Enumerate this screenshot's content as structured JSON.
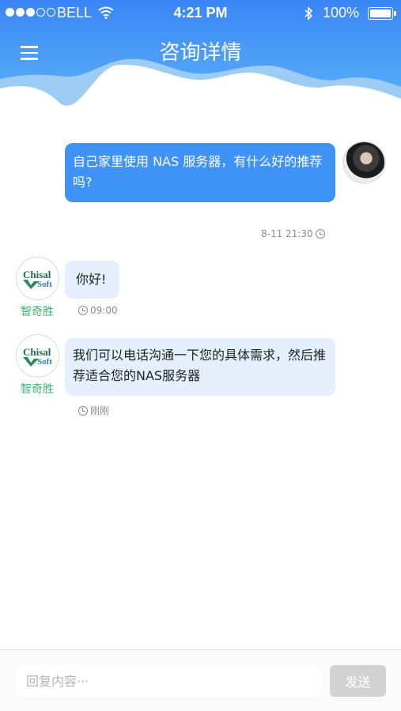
{
  "status_bar": {
    "carrier": "BELL",
    "time": "4:21 PM",
    "battery": "100%"
  },
  "header": {
    "title": "咨询详情"
  },
  "messages": {
    "outgoing": {
      "text": "自己家里使用 NAS 服务器，有什么好的推荐吗?",
      "timestamp": "8-11 21:30"
    },
    "incoming": [
      {
        "sender": "智奇胜",
        "text": "你好!",
        "timestamp": "09:00"
      },
      {
        "sender": "智奇胜",
        "text": "我们可以电话沟通一下您的具体需求，然后推荐适合您的NAS服务器",
        "timestamp": "刚刚"
      }
    ]
  },
  "agent_logo": {
    "line1": "Chisal",
    "line2": "Soft"
  },
  "composer": {
    "placeholder": "回复内容···",
    "send_label": "发送"
  },
  "colors": {
    "header_blue": "#3f93f6",
    "bubble_out": "#3f93f6",
    "bubble_in": "#e4effb",
    "agent_name": "#3cb371"
  },
  "icons": [
    "menu-icon",
    "wifi-icon",
    "bluetooth-icon",
    "battery-icon",
    "clock-icon"
  ]
}
